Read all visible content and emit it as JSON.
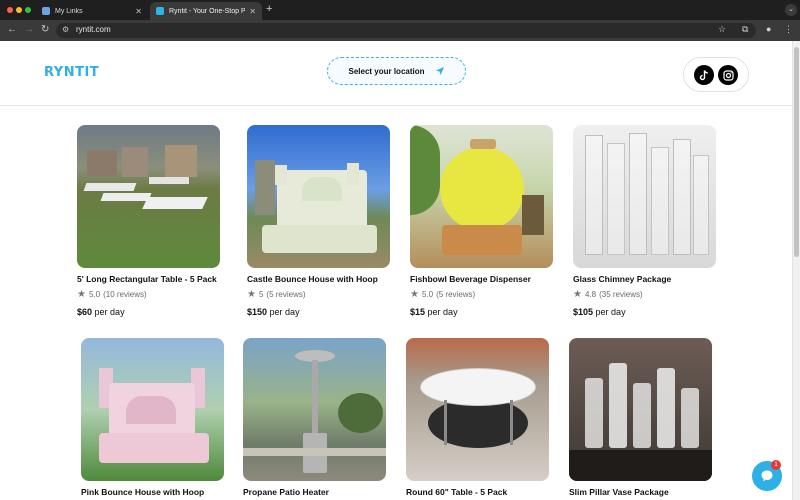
{
  "browser": {
    "tabs": [
      {
        "title": "My Links",
        "active": false
      },
      {
        "title": "Ryntit - Your One-Stop Party",
        "active": true
      }
    ],
    "new_tab_symbol": "+",
    "url": "ryntit.com",
    "icons": {
      "back": "arrow-left-icon",
      "forward": "arrow-right-icon",
      "reload": "reload-icon",
      "bookmark": "star-icon",
      "extensions": "puzzle-icon",
      "account": "person-icon",
      "menu": "kebab-menu-icon"
    }
  },
  "header": {
    "logo": "RYNTIT",
    "location_button": "Select your location",
    "social": [
      "tiktok-icon",
      "instagram-icon"
    ],
    "brand_color": "#2cb0e6"
  },
  "products": [
    {
      "name": "5' Long Rectangular Table - 5 Pack",
      "rating": "5.0",
      "reviews": "(10 reviews)",
      "price": "$60",
      "unit": "per day"
    },
    {
      "name": "Castle Bounce House with Hoop",
      "rating": "5",
      "reviews": "(5 reviews)",
      "price": "$150",
      "unit": "per day"
    },
    {
      "name": "Fishbowl Beverage Dispenser",
      "rating": "5.0",
      "reviews": "(5 reviews)",
      "price": "$15",
      "unit": "per day"
    },
    {
      "name": "Glass Chimney Package",
      "rating": "4.8",
      "reviews": "(35 reviews)",
      "price": "$105",
      "unit": "per day"
    },
    {
      "name": "Pink Bounce House with Hoop"
    },
    {
      "name": "Propane Patio Heater"
    },
    {
      "name": "Round 60\" Table - 5 Pack"
    },
    {
      "name": "Slim Pillar Vase Package"
    }
  ],
  "chat": {
    "badge_count": "1"
  }
}
